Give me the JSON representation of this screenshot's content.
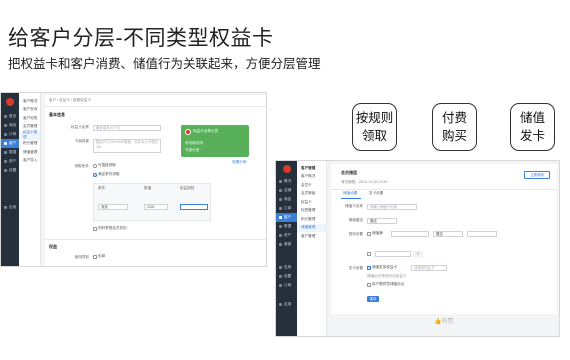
{
  "header": {
    "title": "给客户分层-不同类型权益卡",
    "subtitle": "把权益卡和客户消费、储值行为关联起来，方便分层管理"
  },
  "callouts": [
    "按规则\n领取",
    "付费\n购买",
    "储值\n发卡"
  ],
  "left_app": {
    "sidebar": [
      "首页",
      "商品",
      "订单",
      "客户",
      "数据",
      "资产",
      "设置",
      "应用"
    ],
    "submenu": [
      "客户概况",
      "客户查询",
      "客户标签",
      "会员管理",
      "权益卡管理",
      "积分管理",
      "储值管理",
      "客户导入"
    ],
    "breadcrumb": "客户 / 权益卡 / 新建权益卡",
    "section": "基本信息",
    "fields": {
      "name_label": "权益卡名称",
      "name_placeholder": "最多填写10个字",
      "cover_label": "卡面背景",
      "cover_placeholder": "建议尺寸1000*600像素，文件大小不超过1M",
      "collect_label": "领取条件",
      "collect_option_a": "可直接领取",
      "collect_option_b": "满足条件领取",
      "table_headers": [
        "条件",
        "数值",
        "权益规则"
      ],
      "rule_button": "添加",
      "rule_value_a": "消费",
      "rule_value_b": "1000",
      "checkbox_label": "同时享受会员折扣"
    },
    "preview": {
      "card_title": "权益卡名称示意",
      "card_sub": "有效期说明",
      "card_foot": "专属优惠"
    },
    "preview_link": "查看示例",
    "section_2": "权益",
    "bottom_label": "使用须知",
    "bottom_value": "包邮"
  },
  "right_app": {
    "sidebar": [
      "概况",
      "店铺",
      "商品",
      "订单",
      "客户",
      "数据",
      "资产",
      "营销",
      "应用",
      "设置",
      "订单",
      "应用"
    ],
    "submenu_title": "客户管理",
    "submenu": [
      "客户概况",
      "会员卡",
      "会员等级",
      "权益卡",
      "标签管理",
      "积分管理",
      "储值管理",
      "客户管理"
    ],
    "page_title": "会员储值",
    "page_sub": "有效期限：2019-12-26 23:59",
    "top_button": "立即使用",
    "tabs": [
      "储值设置",
      "发卡设置"
    ],
    "fields": {
      "card_name_label": "储值卡名称",
      "card_name_value": "请输入储值卡名称",
      "gift_label": "储值赠送",
      "gift_value": "赠送",
      "rule_label": "规则设置",
      "rule_value": "储值满",
      "amount_value": "赠送",
      "issue_label": "发卡设置",
      "issue_checkbox": "储值发放权益卡",
      "issue_select": "请选择权益卡",
      "note_text": "储值后可获得对应权益卡",
      "agree_text": "用户需同意储值协议",
      "confirm_button": "保存"
    },
    "watermark": "有赞"
  }
}
